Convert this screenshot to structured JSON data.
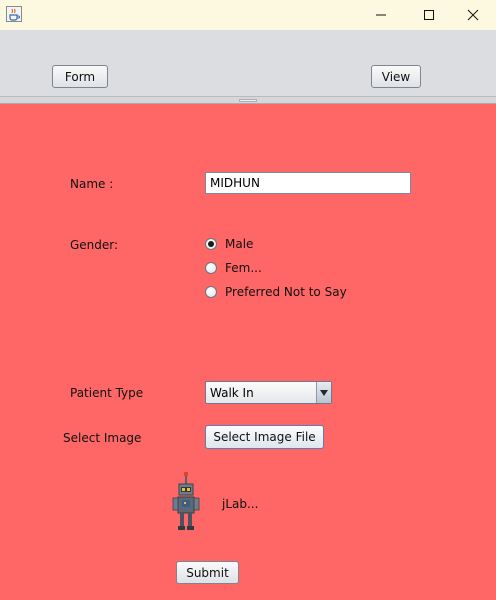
{
  "window": {
    "icon": "java-cup-icon",
    "controls": {
      "minimize": "minimize-icon",
      "maximize": "maximize-icon",
      "close": "close-icon"
    }
  },
  "toolbar": {
    "form_label": "Form",
    "view_label": "View"
  },
  "form": {
    "background_color": "#ff6666",
    "name_label": "Name :",
    "name_value": "MIDHUN",
    "gender_label": "Gender:",
    "gender_options": [
      {
        "label": "Male",
        "selected": true
      },
      {
        "label": "Fem...",
        "selected": false
      },
      {
        "label": "Preferred Not to Say",
        "selected": false
      }
    ],
    "patient_type_label": "Patient Type",
    "patient_type_value": "Walk In",
    "select_image_label": "Select Image",
    "select_image_button": "Select Image File",
    "image_icon": "robot-icon",
    "image_caption": "jLab...",
    "submit_label": "Submit"
  }
}
